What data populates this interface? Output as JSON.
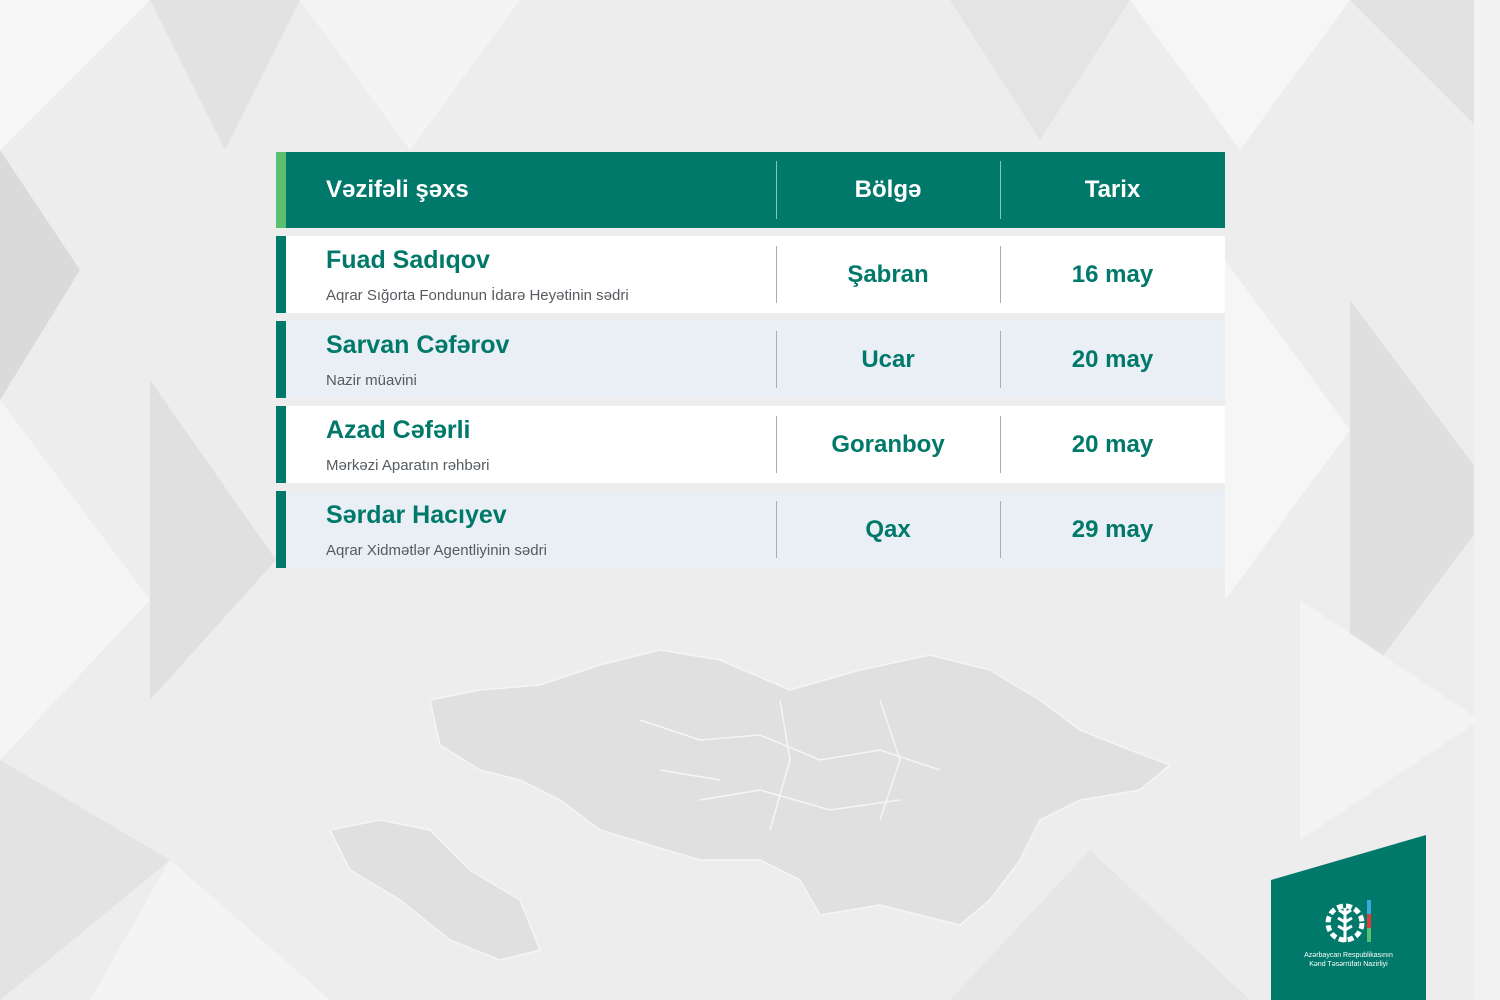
{
  "colors": {
    "brand_green": "#00796b",
    "accent_light_green": "#5cbf70",
    "row_alt_blue": "#e9eff5",
    "row_white": "#ffffff",
    "role_gray": "#555b60"
  },
  "table": {
    "headers": {
      "person": "Vəzifəli şəxs",
      "region": "Bölgə",
      "date": "Tarix"
    },
    "rows": [
      {
        "name": "Fuad Sadıqov",
        "role": "Aqrar Sığorta Fondunun İdarə Heyətinin sədri",
        "region": "Şabran",
        "date": "16 may"
      },
      {
        "name": "Sarvan Cəfərov",
        "role": "Nazir müavini",
        "region": "Ucar",
        "date": "20 may"
      },
      {
        "name": "Azad Cəfərli",
        "role": "Mərkəzi Aparatın rəhbəri",
        "region": "Goranboy",
        "date": "20 may"
      },
      {
        "name": "Sərdar Hacıyev",
        "role": "Aqrar Xidmətlər Agentliyinin sədri",
        "region": "Qax",
        "date": "29 may"
      }
    ]
  },
  "logo": {
    "icon": "gear-wheat-icon",
    "line1": "Azərbaycan Respublikasının",
    "line2": "Kənd Təsərrüfatı Nazirliyi"
  }
}
